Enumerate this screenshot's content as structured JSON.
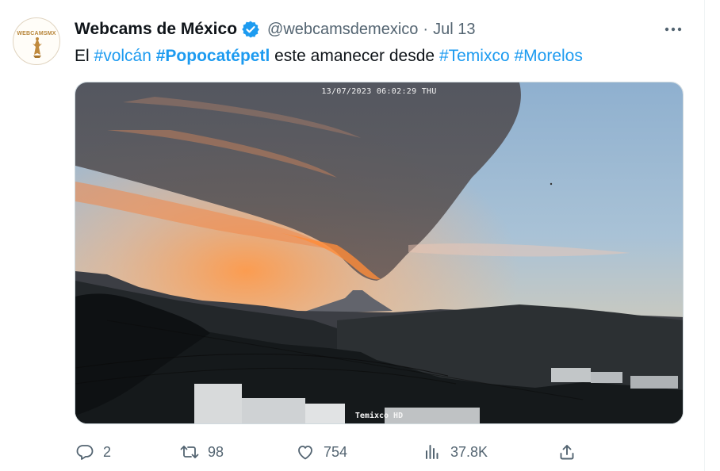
{
  "tweet": {
    "avatar_text": "WEBCAMSMX",
    "display_name": "Webcams de México",
    "handle": "@webcamsdemexico",
    "separator": "·",
    "date": "Jul 13",
    "text": {
      "part1": "El ",
      "tag1": "#volcán",
      "space1": " ",
      "tag2": "#Popocatépetl",
      "part2": " este amanecer desde ",
      "tag3": "#Temixco",
      "space2": " ",
      "tag4": "#Morelos"
    },
    "media": {
      "timestamp": "13/07/2023 06:02:29 THU",
      "caption": "Temixco HD"
    },
    "actions": {
      "replies": "2",
      "retweets": "98",
      "likes": "754",
      "views": "37.8K"
    }
  },
  "icons": {
    "verified": "verified-badge-icon",
    "more": "more-options-icon",
    "reply": "reply-icon",
    "retweet": "retweet-icon",
    "like": "heart-icon",
    "views": "views-chart-icon",
    "share": "share-icon"
  },
  "colors": {
    "accent": "#1d9bf0",
    "secondary_text": "#536471",
    "primary_text": "#0f1419"
  }
}
